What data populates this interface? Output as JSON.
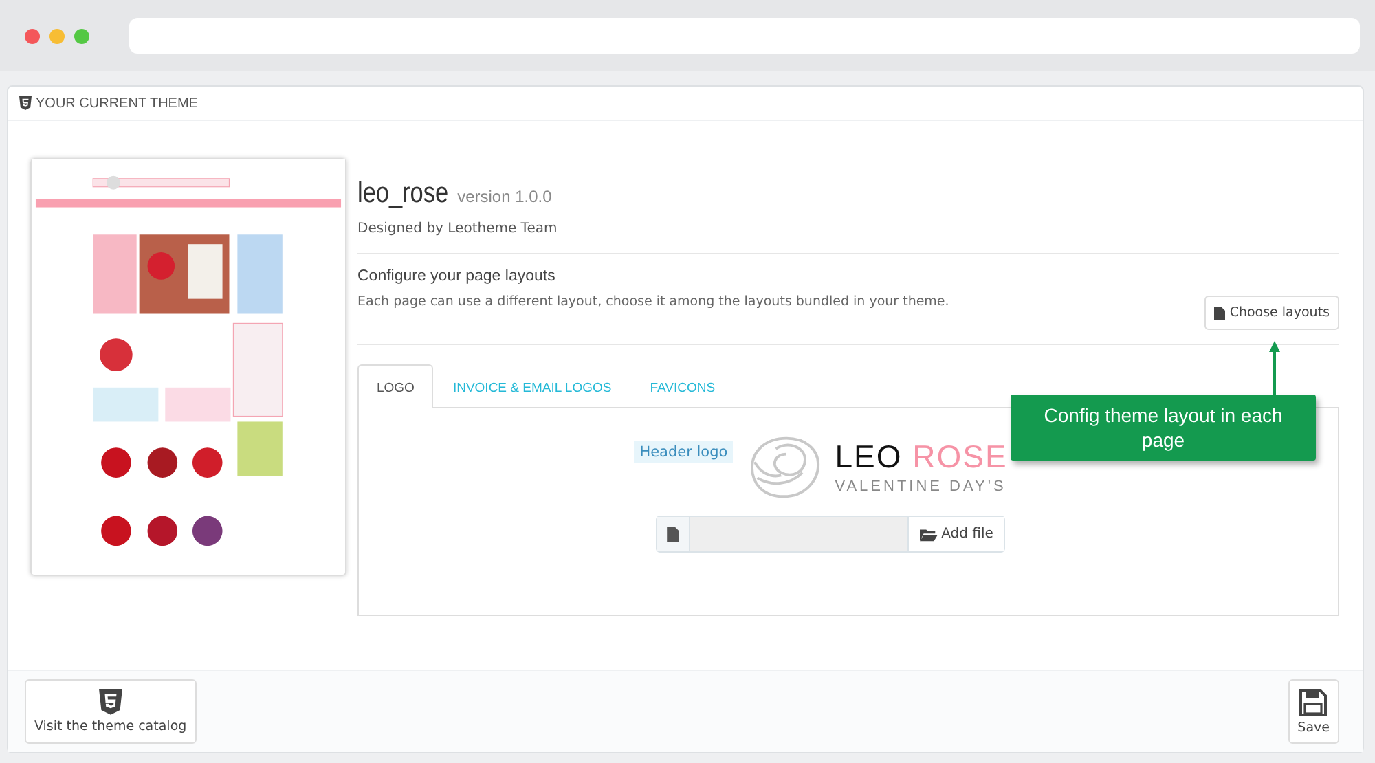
{
  "panel": {
    "title": "YOUR CURRENT THEME"
  },
  "theme": {
    "name": "leo_rose",
    "version": "version 1.0.0",
    "designer": "Designed by Leotheme Team"
  },
  "layouts": {
    "heading": "Configure your page layouts",
    "description": "Each page can use a different layout, choose it among the layouts bundled in your theme.",
    "button": "Choose layouts"
  },
  "tabs": [
    {
      "label": "LOGO",
      "selected": true
    },
    {
      "label": "INVOICE & EMAIL LOGOS",
      "selected": false
    },
    {
      "label": "FAVICONS",
      "selected": false
    }
  ],
  "logo_field": {
    "label": "Header logo",
    "logo_word_1": "LEO",
    "logo_word_2": "ROSE",
    "logo_tagline": "VALENTINE DAY'S",
    "file_button": "Add file"
  },
  "callout": {
    "text": "Config theme layout in each page"
  },
  "footer": {
    "catalog_button": "Visit the theme catalog",
    "save_button": "Save"
  }
}
